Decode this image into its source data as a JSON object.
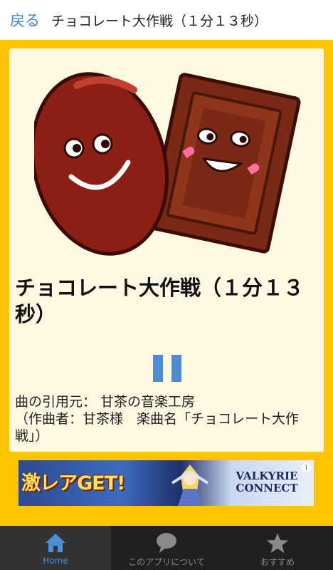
{
  "header": {
    "back_label": "戻る",
    "title": "チョコレート大作戦（１分１３秒）"
  },
  "player": {
    "song_title": "チョコレート大作戦（１分１３秒）",
    "credit": "曲の引用元： 甘茶の音楽工房\n（作曲者：甘茶様　楽曲名「チョコレート大作戦」）",
    "state": "playing"
  },
  "ad": {
    "text_left": "激レアGET!",
    "text_right": "VALKYRIE CONNECT",
    "info_icon": "info-icon"
  },
  "nav": {
    "items": [
      {
        "label": "Home",
        "icon": "home-icon",
        "active": true
      },
      {
        "label": "このアプリについて",
        "icon": "speech-bubble-icon",
        "active": false
      },
      {
        "label": "おすすめ",
        "icon": "star-icon",
        "active": false
      }
    ]
  },
  "colors": {
    "accent_blue": "#3a87d6",
    "background_yellow": "#ffc400",
    "card_background": "#fff9e4",
    "nav_background": "#202020"
  }
}
